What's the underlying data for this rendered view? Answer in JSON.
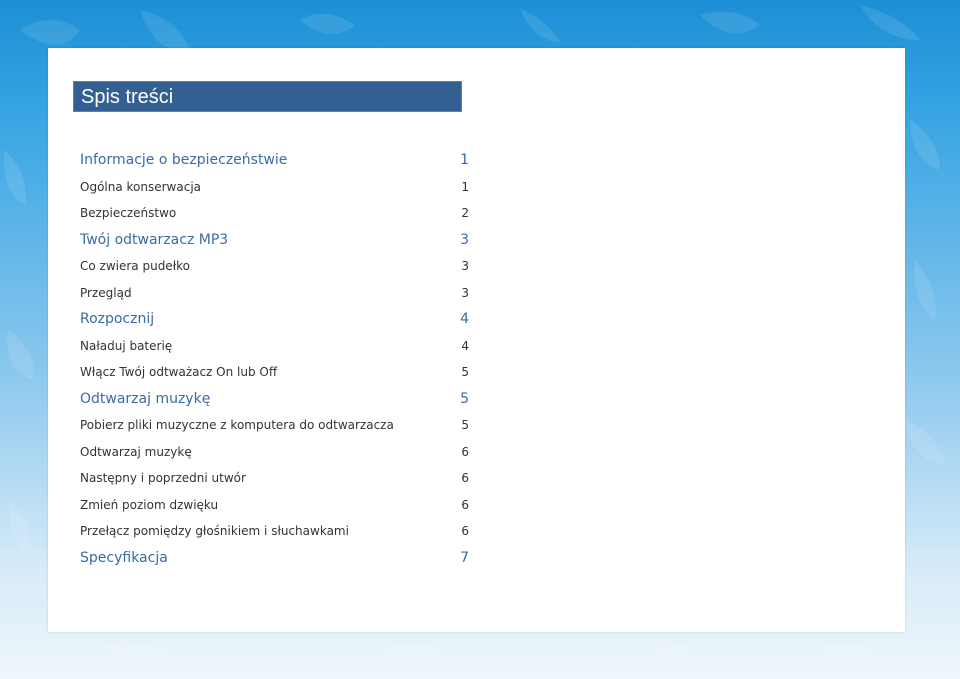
{
  "toc": {
    "title": "Spis treści",
    "entries": [
      {
        "label": "Informacje o bezpieczeństwie",
        "page": "1",
        "level": 1
      },
      {
        "label": "Ogólna konserwacja",
        "page": "1",
        "level": 2
      },
      {
        "label": "Bezpieczeństwo",
        "page": "2",
        "level": 2
      },
      {
        "label": "Twój odtwarzacz MP3",
        "page": "3",
        "level": 1
      },
      {
        "label": "Co zwiera pudełko",
        "page": "3",
        "level": 2
      },
      {
        "label": "Przegląd",
        "page": "3",
        "level": 2
      },
      {
        "label": "Rozpocznij",
        "page": "4",
        "level": 1
      },
      {
        "label": "Naładuj baterię",
        "page": "4",
        "level": 2
      },
      {
        "label": "Włącz Twój odtważacz On lub Off",
        "page": "5",
        "level": 2
      },
      {
        "label": "Odtwarzaj muzykę",
        "page": "5",
        "level": 1
      },
      {
        "label": "Pobierz pliki muzyczne z komputera do odtwarzacza",
        "page": "5",
        "level": 2
      },
      {
        "label": "Odtwarzaj muzykę",
        "page": "6",
        "level": 2
      },
      {
        "label": "Następny i poprzedni utwór",
        "page": "6",
        "level": 2
      },
      {
        "label": "Zmień poziom dzwięku",
        "page": "6",
        "level": 2
      },
      {
        "label": "Przełącz pomiędzy głośnikiem i słuchawkami",
        "page": "6",
        "level": 2
      },
      {
        "label": "Specyfikacja",
        "page": "7",
        "level": 1
      }
    ]
  },
  "colors": {
    "header_bg": "#345f92",
    "heading_text": "#3b6aa4",
    "body_text": "#333333",
    "background_blue": "#1d8fd6"
  }
}
